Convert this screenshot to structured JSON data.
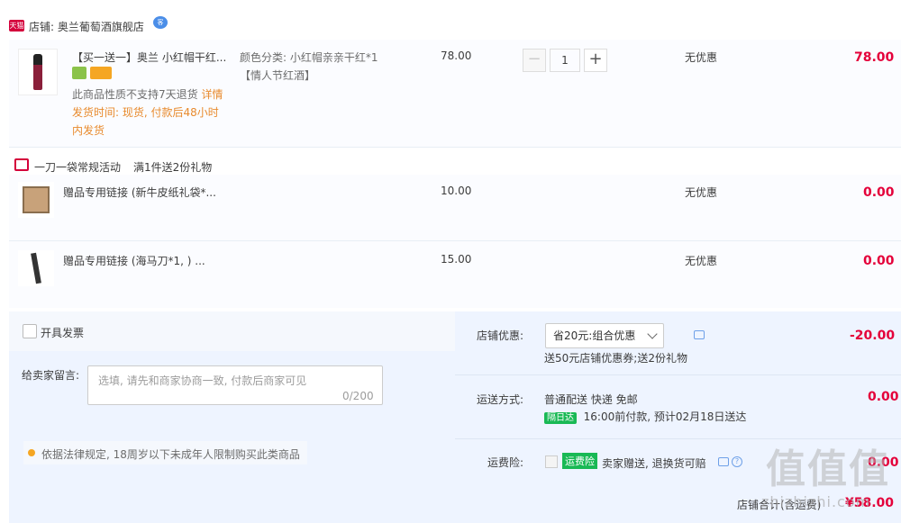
{
  "shop": {
    "tag": "天猫",
    "label": "店铺: 奥兰葡萄酒旗舰店",
    "chat_badge": "客"
  },
  "main_item": {
    "title": "【买一送一】奥兰 小红帽干红...",
    "sku": "颜色分类: 小红帽亲亲干红*1",
    "sku_sub": "【情人节红酒】",
    "notice": "此商品性质不支持7天退货",
    "notice_link": "详情",
    "ship_line1": "发货时间: 现货, 付款后48小时",
    "ship_line2": "内发货",
    "unit_price": "78.00",
    "quantity": "1",
    "discount": "无优惠",
    "subtotal": "78.00"
  },
  "promotion": {
    "text": "一刀一袋常规活动",
    "rule": "满1件送2份礼物"
  },
  "gifts": [
    {
      "title": "赠品专用链接 (新牛皮纸礼袋*...",
      "price": "10.00",
      "discount": "无优惠",
      "subtotal": "0.00"
    },
    {
      "title": "赠品专用链接 (海马刀*1, )  ...",
      "price": "15.00",
      "discount": "无优惠",
      "subtotal": "0.00"
    }
  ],
  "invoice": {
    "label": "开具发票"
  },
  "message": {
    "label": "给卖家留言:",
    "placeholder": "选填, 请先和商家协商一致, 付款后商家可见",
    "counter": "0/200"
  },
  "legal": {
    "text": "依据法律规定, 18周岁以下未成年人限制购买此类商品"
  },
  "shop_discount": {
    "label": "店铺优惠:",
    "selected": "省20元:组合优惠",
    "detail": "送50元店铺优惠券;送2份礼物",
    "amount": "-20.00"
  },
  "delivery": {
    "label": "运送方式:",
    "method": "普通配送 快递 免邮",
    "tag": "隔日达",
    "eta": "16:00前付款, 预计02月18日送达",
    "amount": "0.00"
  },
  "freight_insurance": {
    "label": "运费险:",
    "tag": "运费险",
    "text": "卖家赠送, 退换货可赔",
    "amount": "0.00"
  },
  "total": {
    "label": "店铺合计(含运费)",
    "amount": "¥58.00"
  },
  "watermark": {
    "main": "值值值",
    "sub": "zhizhizhi.com"
  },
  "colors": {
    "price_red": "#e4003a",
    "orange": "#e88a2d",
    "green_tag": "#19b955",
    "panel_bg": "#eef4ff"
  }
}
